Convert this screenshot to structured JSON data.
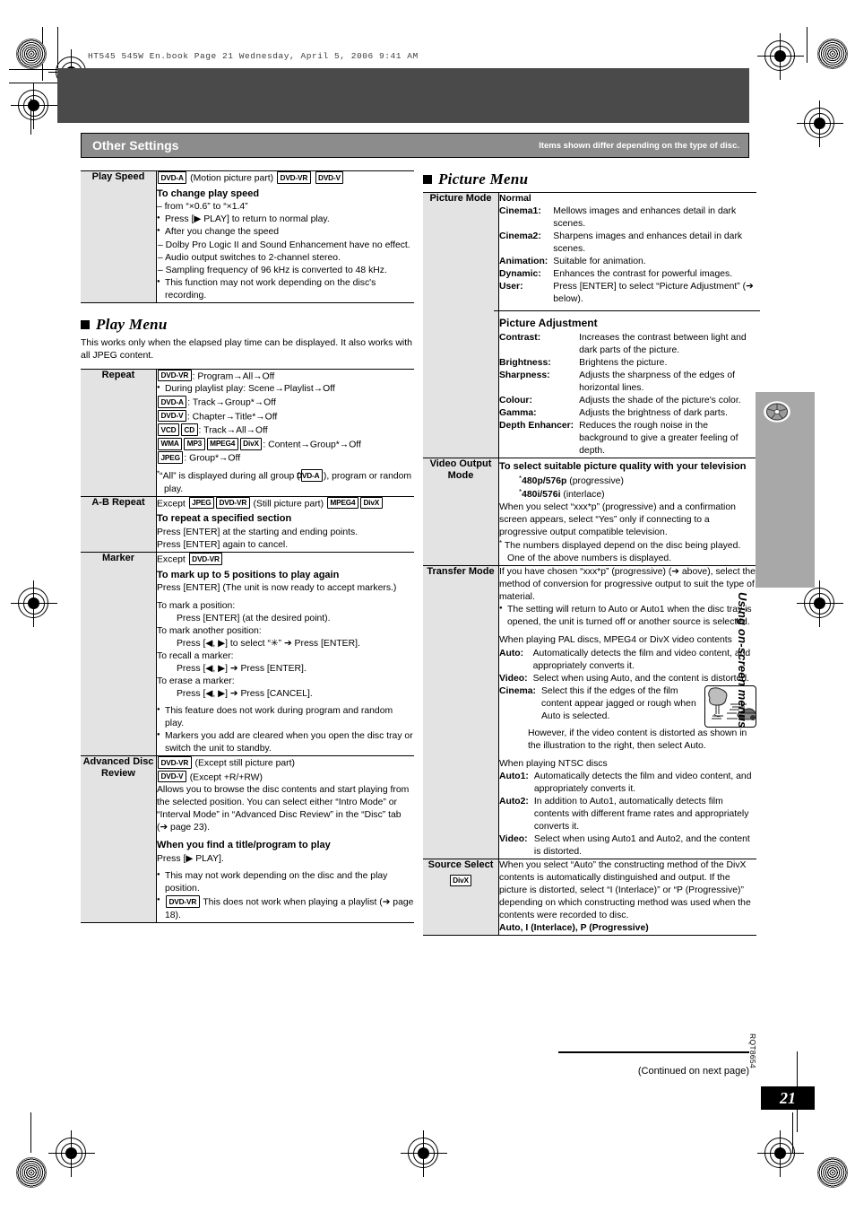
{
  "file_header": "HT545 545W En.book  Page 21  Wednesday, April 5, 2006  9:41 AM",
  "titlebar": {
    "left": "Other Settings",
    "right": "Items shown differ depending on the type of disc."
  },
  "side_tab": {
    "label": "Using on-screen menus",
    "icon": "disc-icon"
  },
  "footer": {
    "continued": "(Continued on next page)",
    "code": "RQT8654",
    "page": "21"
  },
  "left_column": {
    "play_speed_table": {
      "rows": [
        {
          "label": "Play Speed",
          "badges_line": {
            "badges": [
              "DVD-A"
            ],
            "after": "(Motion picture part)",
            "badges2": [
              "DVD-VR",
              "DVD-V"
            ]
          },
          "heading": "To change play speed",
          "lines": [
            "– from “×0.6” to “×1.4”",
            "Press [▶ PLAY] to return to normal play.",
            "After you change the speed",
            "– Dolby Pro Logic II and Sound Enhancement have no effect.",
            "– Audio output switches to 2-channel stereo.",
            "– Sampling frequency of 96 kHz is converted to 48 kHz.",
            "This function may not work depending on the disc's recording."
          ]
        }
      ]
    },
    "play_menu": {
      "heading": "Play Menu",
      "intro": "This works only when the elapsed play time can be displayed. It also works with all JPEG content.",
      "rows": [
        {
          "label": "Repeat",
          "lines": [
            {
              "badges": [
                "DVD-VR"
              ],
              "text": ": Program→All→Off"
            },
            {
              "bullet": true,
              "text": "During playlist play: Scene→Playlist→Off"
            },
            {
              "badges": [
                "DVD-A"
              ],
              "text": ": Track→Group*→Off"
            },
            {
              "badges": [
                "DVD-V"
              ],
              "text": ": Chapter→Title*→Off"
            },
            {
              "badges": [
                "VCD",
                "CD"
              ],
              "text": ": Track→All→Off"
            },
            {
              "badges": [
                "WMA",
                "MP3",
                "MPEG4",
                "DivX"
              ],
              "text": ": Content→Group*→Off"
            },
            {
              "badges": [
                "JPEG"
              ],
              "text": ": Group*→Off"
            }
          ],
          "note_pre": "“All” is displayed during all group (",
          "note_badge": "DVD-A",
          "note_post": "), program or random play."
        },
        {
          "label": "A-B Repeat",
          "except_pre": "Except",
          "except_badges": [
            "JPEG",
            "DVD-VR"
          ],
          "except_mid": "(Still picture part)",
          "except_badges2": [
            "MPEG4",
            "DivX"
          ],
          "heading": "To repeat a specified section",
          "lines": [
            "Press [ENTER] at the starting and ending points.",
            "Press [ENTER] again to cancel."
          ]
        },
        {
          "label": "Marker",
          "except_pre": "Except",
          "except_badges": [
            "DVD-VR"
          ],
          "heading": "To mark up to 5 positions to play again",
          "lead": "Press [ENTER] (The unit is now ready to accept markers.)",
          "steps": [
            {
              "t": "To mark a position:",
              "s": "Press [ENTER] (at the desired point)."
            },
            {
              "t": "To mark another position:",
              "s": "Press [◀, ▶] to select “✳” ➔ Press [ENTER]."
            },
            {
              "t": "To recall a marker:",
              "s": "Press [◀, ▶] ➔ Press [ENTER]."
            },
            {
              "t": "To erase a marker:",
              "s": "Press [◀, ▶] ➔ Press [CANCEL]."
            }
          ],
          "bullets": [
            "This feature does not work during program and random play.",
            "Markers you add are cleared when you open the disc tray or switch the unit to standby."
          ]
        },
        {
          "label": "Advanced Disc Review",
          "badge_lines": [
            {
              "badge": "DVD-VR",
              "text": "(Except still picture part)"
            },
            {
              "badge": "DVD-V",
              "text": "(Except +R/+RW)"
            }
          ],
          "para": "Allows you to browse the disc contents and start playing from the selected position. You can select either “Intro Mode” or “Interval Mode” in “Advanced Disc Review” in the “Disc” tab (➔ page 23).",
          "heading": "When you find a title/program to play",
          "lead": "Press [▶ PLAY].",
          "bullets": [
            "This may not work depending on the disc and the play position."
          ],
          "bullet_badge": "DVD-VR",
          "bullet_badge_text": "This does not work when playing a playlist (➔ page 18)."
        }
      ]
    }
  },
  "right_column": {
    "picture_menu": {
      "heading": "Picture Menu",
      "rows": [
        {
          "label": "Picture Mode",
          "normal": "Normal",
          "modes": [
            {
              "k": "Cinema1:",
              "v": "Mellows images and enhances detail in dark scenes."
            },
            {
              "k": "Cinema2:",
              "v": "Sharpens images and enhances detail in dark scenes."
            },
            {
              "k": "Animation:",
              "v": "Suitable for animation."
            },
            {
              "k": "Dynamic:",
              "v": "Enhances the contrast for powerful images."
            },
            {
              "k": "User:",
              "v": "Press [ENTER] to select “Picture Adjustment” (➔ below)."
            }
          ],
          "adjust_heading": "Picture Adjustment",
          "adjustments": [
            {
              "k": "Contrast:",
              "v": "Increases the contrast between light and dark parts of the picture."
            },
            {
              "k": "Brightness:",
              "v": "Brightens the picture."
            },
            {
              "k": "Sharpness:",
              "v": "Adjusts the sharpness of the edges of horizontal lines."
            },
            {
              "k": "Colour:",
              "v": "Adjusts the shade of the picture's color."
            },
            {
              "k": "Gamma:",
              "v": "Adjusts the brightness of dark parts."
            },
            {
              "k": "Depth Enhancer:",
              "v": "Reduces the rough noise in the background to give a greater feeling of depth."
            }
          ]
        },
        {
          "label": "Video Output Mode",
          "heading": "To select suitable picture quality with your television",
          "options": [
            {
              "bold": "480p/576p",
              "rest": "(progressive)"
            },
            {
              "bold": "480i/576i",
              "rest": "(interlace)"
            }
          ],
          "para": "When you select “xxx*p” (progressive) and a confirmation screen appears, select “Yes” only if connecting to a progressive output compatible television.",
          "note": "The numbers displayed depend on the disc being played. One of the above numbers is displayed."
        },
        {
          "label": "Transfer Mode",
          "para1": "If you have chosen “xxx*p” (progressive) (➔ above), select the method of conversion for progressive output to suit the type of material.",
          "bullet1": "The setting will return to Auto or Auto1 when the disc tray is opened, the unit is turned off or another source is selected.",
          "pal_heading": "When playing PAL discs, MPEG4 or DivX video contents",
          "pal": [
            {
              "k": "Auto:",
              "v": "Automatically detects the film and video content, and appropriately converts it."
            },
            {
              "k": "Video:",
              "v": "Select when using Auto, and the content is distorted."
            },
            {
              "k": "Cinema:",
              "v": "Select this if the edges of the film content appear jagged or rough when Auto is selected."
            }
          ],
          "cinema_extra": "However, if the video content is distorted as shown in the illustration to the right, then select Auto.",
          "illustration": "distorted-video-illustration",
          "ntsc_heading": "When playing NTSC discs",
          "ntsc": [
            {
              "k": "Auto1:",
              "v": "Automatically detects the film and video content, and appropriately converts it."
            },
            {
              "k": "Auto2:",
              "v": "In addition to Auto1, automatically detects film contents with different frame rates and appropriately converts it."
            },
            {
              "k": "Video:",
              "v": "Select when using Auto1 and Auto2, and the content is distorted."
            }
          ]
        },
        {
          "label": "Source Select",
          "label_badge": "DivX",
          "para": "When you select “Auto” the constructing method of the DivX contents is automatically distinguished and output. If the picture is distorted, select “I (Interlace)” or “P (Progressive)” depending on which constructing method was used when the contents were recorded to disc.",
          "options_line": "Auto, I (Interlace), P (Progressive)"
        }
      ]
    }
  }
}
